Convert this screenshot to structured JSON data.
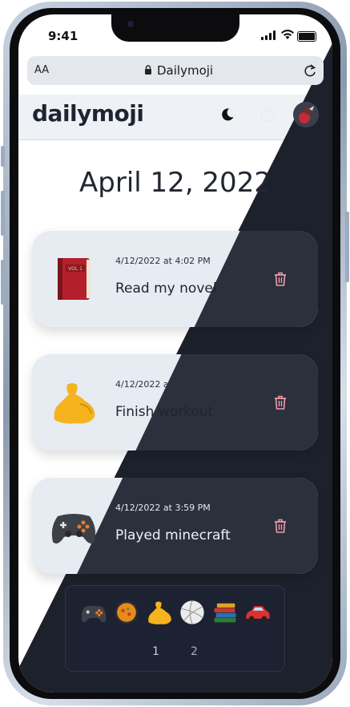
{
  "status_bar": {
    "time": "9:41"
  },
  "browser": {
    "text_size_label": "AA",
    "url": "Dailymoji"
  },
  "app": {
    "logo": "dailymoji"
  },
  "date_heading": "April 12, 2022",
  "entries": [
    {
      "timestamp": "4/12/2022 at 4:02 PM",
      "title": "Read my novel",
      "emoji_icon": "red-book-emoji",
      "book_label": "VOL 1"
    },
    {
      "timestamp": "4/12/2022 at 4:01 PM",
      "title": "Finish workout",
      "emoji_icon": "flexed-biceps-emoji"
    },
    {
      "timestamp": "4/12/2022 at 3:59 PM",
      "title": "Played minecraft",
      "emoji_icon": "game-controller-emoji"
    }
  ],
  "emoji_picker": {
    "emojis": [
      "game-controller-emoji",
      "paella-pan-emoji",
      "flexed-biceps-emoji",
      "volleyball-emoji",
      "books-emoji",
      "red-car-emoji"
    ],
    "pages": [
      "1",
      "2"
    ]
  },
  "colors": {
    "light_bg": "#ffffff",
    "dark_bg": "#1d212c",
    "card_light": "#e7ebf2",
    "card_dark": "#2b303d",
    "trash": "#f39ba8"
  }
}
